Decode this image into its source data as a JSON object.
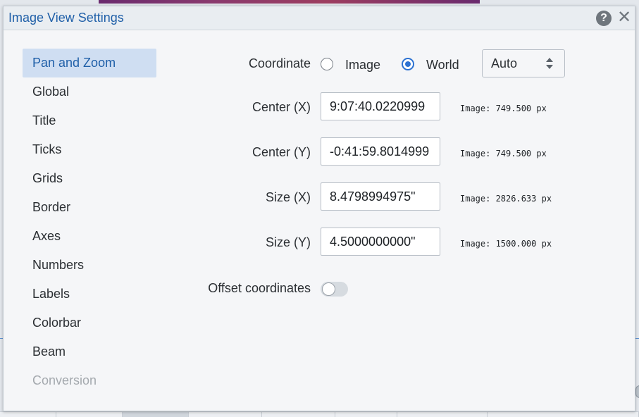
{
  "dialog": {
    "title": "Image View Settings",
    "help_icon": "question-mark-icon",
    "close_icon": "close-icon",
    "help_glyph": "?",
    "close_glyph": "✕"
  },
  "sidebar": {
    "items": [
      {
        "label": "Pan and Zoom",
        "state": "active"
      },
      {
        "label": "Global",
        "state": "normal"
      },
      {
        "label": "Title",
        "state": "normal"
      },
      {
        "label": "Ticks",
        "state": "normal"
      },
      {
        "label": "Grids",
        "state": "normal"
      },
      {
        "label": "Border",
        "state": "normal"
      },
      {
        "label": "Axes",
        "state": "normal"
      },
      {
        "label": "Numbers",
        "state": "normal"
      },
      {
        "label": "Labels",
        "state": "normal"
      },
      {
        "label": "Colorbar",
        "state": "normal"
      },
      {
        "label": "Beam",
        "state": "normal"
      },
      {
        "label": "Conversion",
        "state": "disabled"
      }
    ]
  },
  "pan_zoom": {
    "coordinate_label": "Coordinate",
    "coordinate_options": [
      {
        "label": "Image",
        "checked": false
      },
      {
        "label": "World",
        "checked": true
      }
    ],
    "format_select": "Auto",
    "fields": [
      {
        "label": "Center (X)",
        "value": "9:07:40.0220999",
        "info": "Image: 749.500 px"
      },
      {
        "label": "Center (Y)",
        "value": "-0:41:59.8014999",
        "info": "Image: 749.500 px"
      },
      {
        "label": "Size (X)",
        "value": "8.4798994975\"",
        "info": "Image: 2826.633 px"
      },
      {
        "label": "Size (Y)",
        "value": "4.5000000000\"",
        "info": "Image: 1500.000 px"
      }
    ],
    "offset_label": "Offset coordinates",
    "offset_enabled": false
  },
  "colors": {
    "accent": "#2d72d2",
    "title_blue": "#1f5fa8",
    "active_nav_bg": "#cfdef2"
  }
}
